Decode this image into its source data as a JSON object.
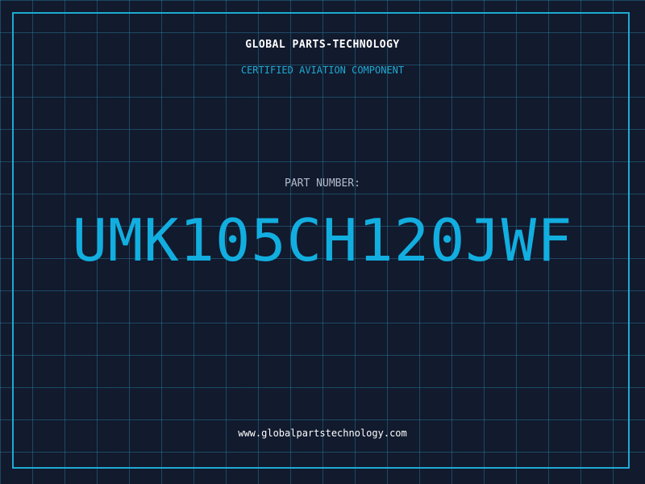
{
  "brand": {
    "name": "GLOBAL PARTS-TECHNOLOGY",
    "tagline": "CERTIFIED AVIATION COMPONENT"
  },
  "part": {
    "label": "PART NUMBER:",
    "number": "UMK105CH120JWF"
  },
  "footer": {
    "website": "www.globalpartstechnology.com"
  },
  "colors": {
    "background": "#121a2e",
    "grid": "#28829f",
    "accent": "#1eaad2",
    "part_number": "#12aee0",
    "text_primary": "#ffffff",
    "text_muted": "#b4bccb"
  }
}
